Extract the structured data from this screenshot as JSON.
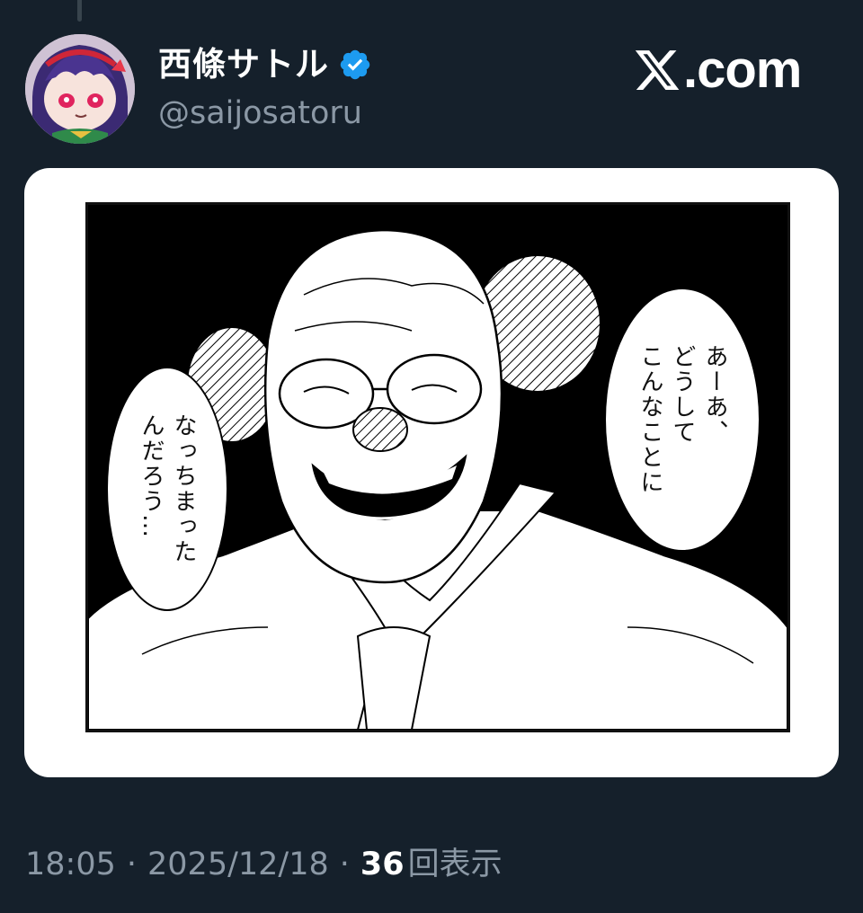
{
  "author": {
    "display_name": "西條サトル",
    "handle": "@saijosatoru",
    "verified": true
  },
  "branding": {
    "site": ".com"
  },
  "media": {
    "speech_right": "あーあ、\nどうして\nこんなことに",
    "speech_left": "なっちまった\nんだろう…"
  },
  "meta": {
    "time": "18:05",
    "separator": "·",
    "date": "2025/12/18",
    "views_count": "36",
    "views_label": "回表示"
  },
  "colors": {
    "background": "#15202b",
    "secondary_text": "#8b98a5",
    "verified_badge": "#1d9bf0"
  }
}
